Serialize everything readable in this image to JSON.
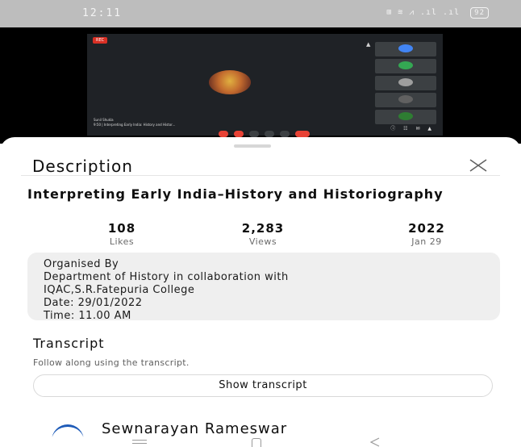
{
  "status_bar": {
    "time": "12:11",
    "icons_text": "⊞ ≋ ⩘ .ıl .ıl",
    "battery": "92"
  },
  "video": {
    "rec_label": "REC",
    "speaker_label": "Sunil Shukla",
    "meeting_title": "9:50 | Interpreting Early India: History and Histor..."
  },
  "sheet": {
    "title": "Description",
    "video_title": "Interpreting Early India–History and Historiography",
    "stats": [
      {
        "value": "108",
        "label": "Likes"
      },
      {
        "value": "2,283",
        "label": "Views"
      },
      {
        "value": "2022",
        "label": "Jan 29"
      }
    ],
    "description_lines": [
      "Organised By",
      "Department of History in collaboration with",
      "IQAC,S.R.Fatepuria College",
      "Date: 29/01/2022",
      "Time: 11.00 AM"
    ],
    "transcript": {
      "title": "Transcript",
      "subtitle": "Follow along using the transcript.",
      "button_label": "Show transcript"
    },
    "channel_name": "Sewnarayan Rameswar"
  },
  "colors": {
    "accent_red": "#e84235",
    "channel_blue": "#1e5bb8",
    "status_bar_bg": "#bdbdbd"
  },
  "icons": [
    "wifi-icon",
    "signal-icon",
    "battery-icon",
    "close-icon",
    "nav-menu-icon",
    "nav-home-icon",
    "nav-back-icon"
  ]
}
